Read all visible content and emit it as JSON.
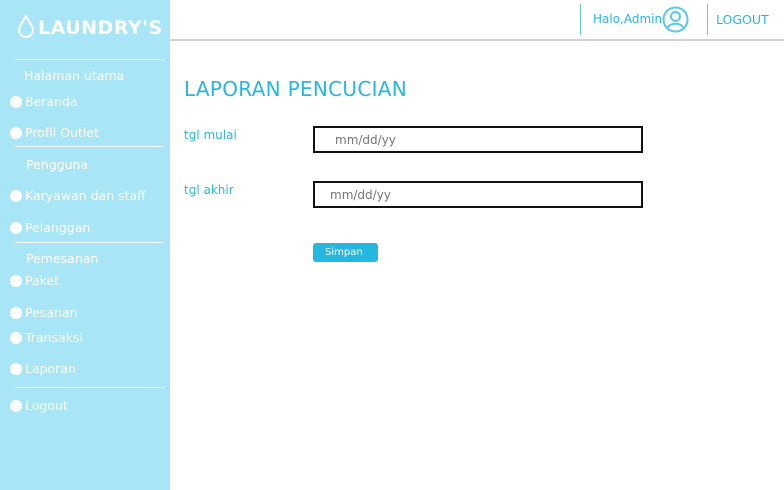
{
  "brand": {
    "name": "LAUNDRY'S",
    "logo_icon": "water-drop-icon"
  },
  "sidebar": {
    "sections": {
      "halaman_utama": "Halaman utama",
      "pengguna": "Pengguna",
      "pemesanan": "Pemesanan"
    },
    "items": [
      {
        "label": "Beranda"
      },
      {
        "label": "Profil Outlet"
      },
      {
        "label": "Karyawan dan staff"
      },
      {
        "label": "Pelanggan"
      },
      {
        "label": "Paket"
      },
      {
        "label": "Pesanan"
      },
      {
        "label": "Transaksi"
      },
      {
        "label": "Laporan"
      },
      {
        "label": "Logout"
      }
    ]
  },
  "header": {
    "greeting": "Halo,Admin",
    "avatar_icon": "user-circle-icon",
    "logout_label": "LOGOUT"
  },
  "main": {
    "title": "LAPORAN PENCUCIAN",
    "start_label": "tgl mulai",
    "start_placeholder": "mm/dd/yy",
    "end_label": "tgl akhir",
    "end_placeholder": "mm/dd/yy",
    "save_label": "Simpan"
  },
  "colors": {
    "sidebar": "#a8e6f7",
    "accent": "#26b7e0",
    "text_light": "#ffffff"
  }
}
